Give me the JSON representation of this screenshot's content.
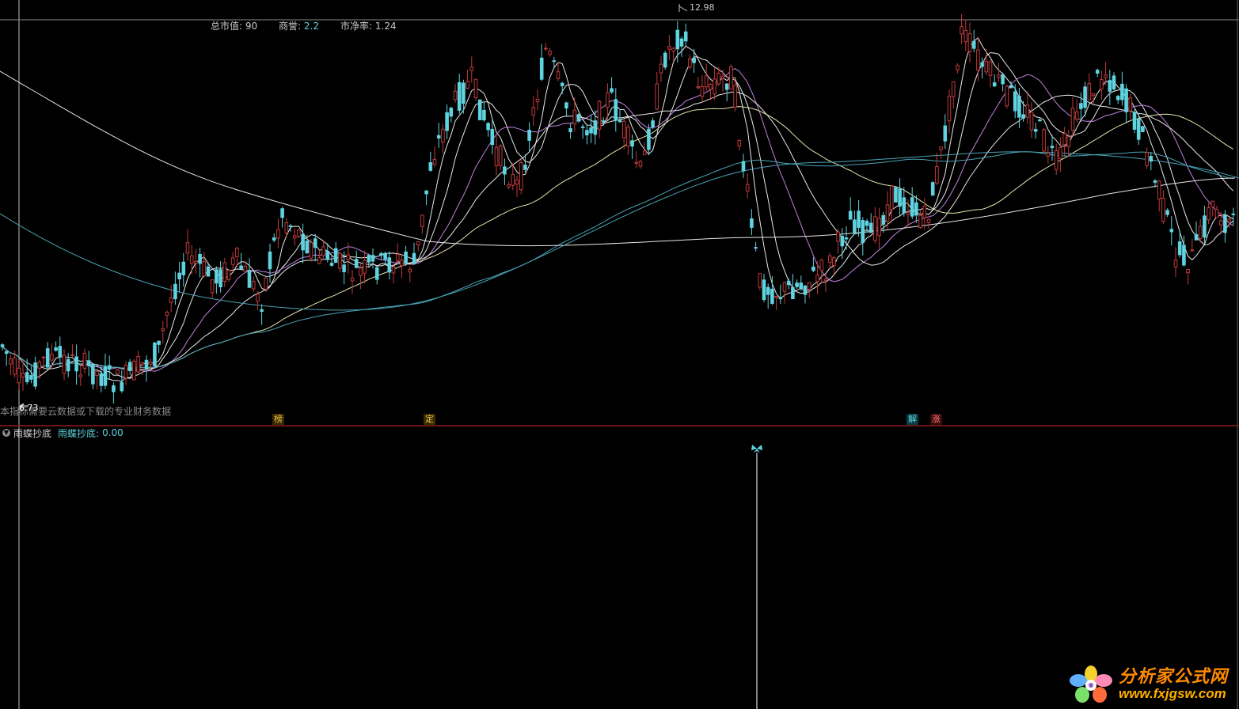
{
  "header": {
    "market_cap_label": "总市值:",
    "market_cap_value": "90",
    "goodwill_label": "商誉:",
    "goodwill_value": "2.2",
    "pb_label": "市净率:",
    "pb_value": "1.24"
  },
  "price_marks": {
    "high_label": "12.98",
    "low_label": "6.73"
  },
  "note_text": "本指标需要云数据或下载的专业财务数据",
  "event_markers": [
    {
      "text": "榜",
      "color": "yellow"
    },
    {
      "text": "定",
      "color": "yellow"
    },
    {
      "text": "解",
      "color": "cyan"
    },
    {
      "text": "涨",
      "color": "red"
    }
  ],
  "indicator": {
    "title": "雨蝶抄底",
    "value_label": "雨蝶抄底:",
    "value": "0.00",
    "signal_icon": "butterfly-icon"
  },
  "brand": {
    "name": "分析家公式网",
    "url": "www.fxjgsw.com",
    "logo_icon": "flower-logo-icon"
  },
  "colors": {
    "background": "#000000",
    "up_candle": "#c03a3a",
    "down_candle": "#5fd3e0",
    "ma_white": "#e8e8e8",
    "ma_purple": "#c080e0",
    "ma_cyan": "#4aa3b5",
    "ma_yellowish": "#e6e6b0",
    "divider": "#8b1a1a"
  }
}
